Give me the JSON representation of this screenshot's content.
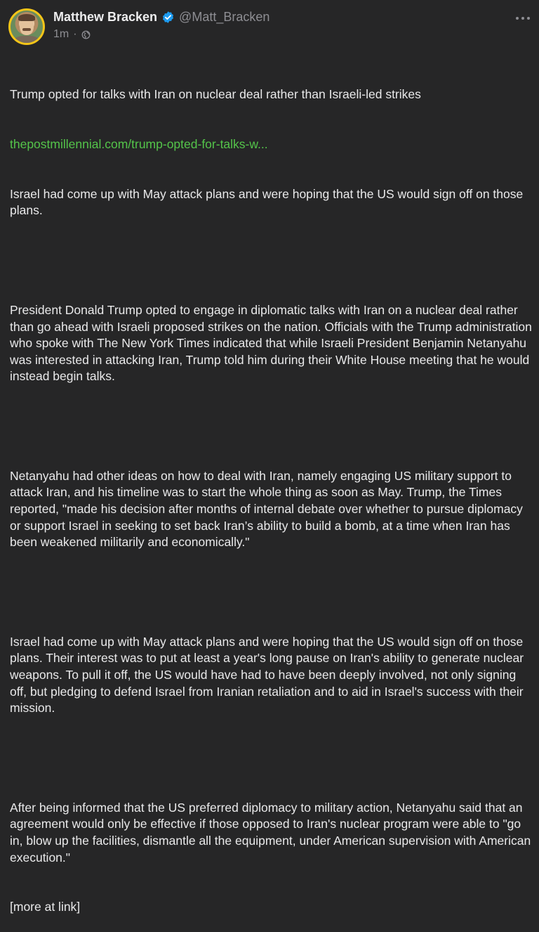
{
  "author": {
    "display_name": "Matthew Bracken",
    "handle": "@Matt_Bracken",
    "verified": true
  },
  "meta": {
    "time": "1m",
    "separator": "·",
    "visibility_icon": "globe-icon"
  },
  "post": {
    "title": "Trump opted for talks with Iran on nuclear deal rather than Israeli-led strikes",
    "link_text": "thepostmillennial.com/trump-opted-for-talks-w...",
    "summary": "Israel had come up with May attack plans and were hoping that the US would sign off on those plans.",
    "paragraphs": [
      "President Donald Trump opted to engage in diplomatic talks with Iran on a nuclear deal rather than go ahead with Israeli proposed strikes on the nation. Officials with the Trump administration who spoke with The New York Times indicated that while Israeli President Benjamin Netanyahu was interested in attacking Iran, Trump told him during their White House meeting that he would instead begin talks.",
      "Netanyahu had other ideas on how to deal with Iran, namely engaging US military support to attack Iran, and his timeline was to start the whole thing as soon as May. Trump, the Times reported, \"made his decision after months of internal debate over whether to pursue diplomacy or support Israel in seeking to set back Iran’s ability to build a bomb, at a time when Iran has been weakened militarily and economically.\"",
      "Israel had come up with May attack plans and were hoping that the US would sign off on those plans. Their interest was to put at least a year's long pause on Iran's ability to generate nuclear weapons. To pull it off, the US would have had to have been deeply involved, not only signing off, but pledging to defend Israel from Iranian retaliation and to aid in Israel's success with their mission.",
      "After being informed that the US preferred diplomacy to military action, Netanyahu said that an agreement would only be effective if those opposed to Iran's nuclear program were able to \"go in, blow up the facilities, dismantle all the equipment, under American supervision with American execution.\""
    ],
    "more_link": "[more at link]"
  },
  "colors": {
    "background": "#262627",
    "link": "#54c44a",
    "verified_badge": "#1d9bf0",
    "muted": "#8e8e93",
    "avatar_ring": "#f5c518"
  }
}
